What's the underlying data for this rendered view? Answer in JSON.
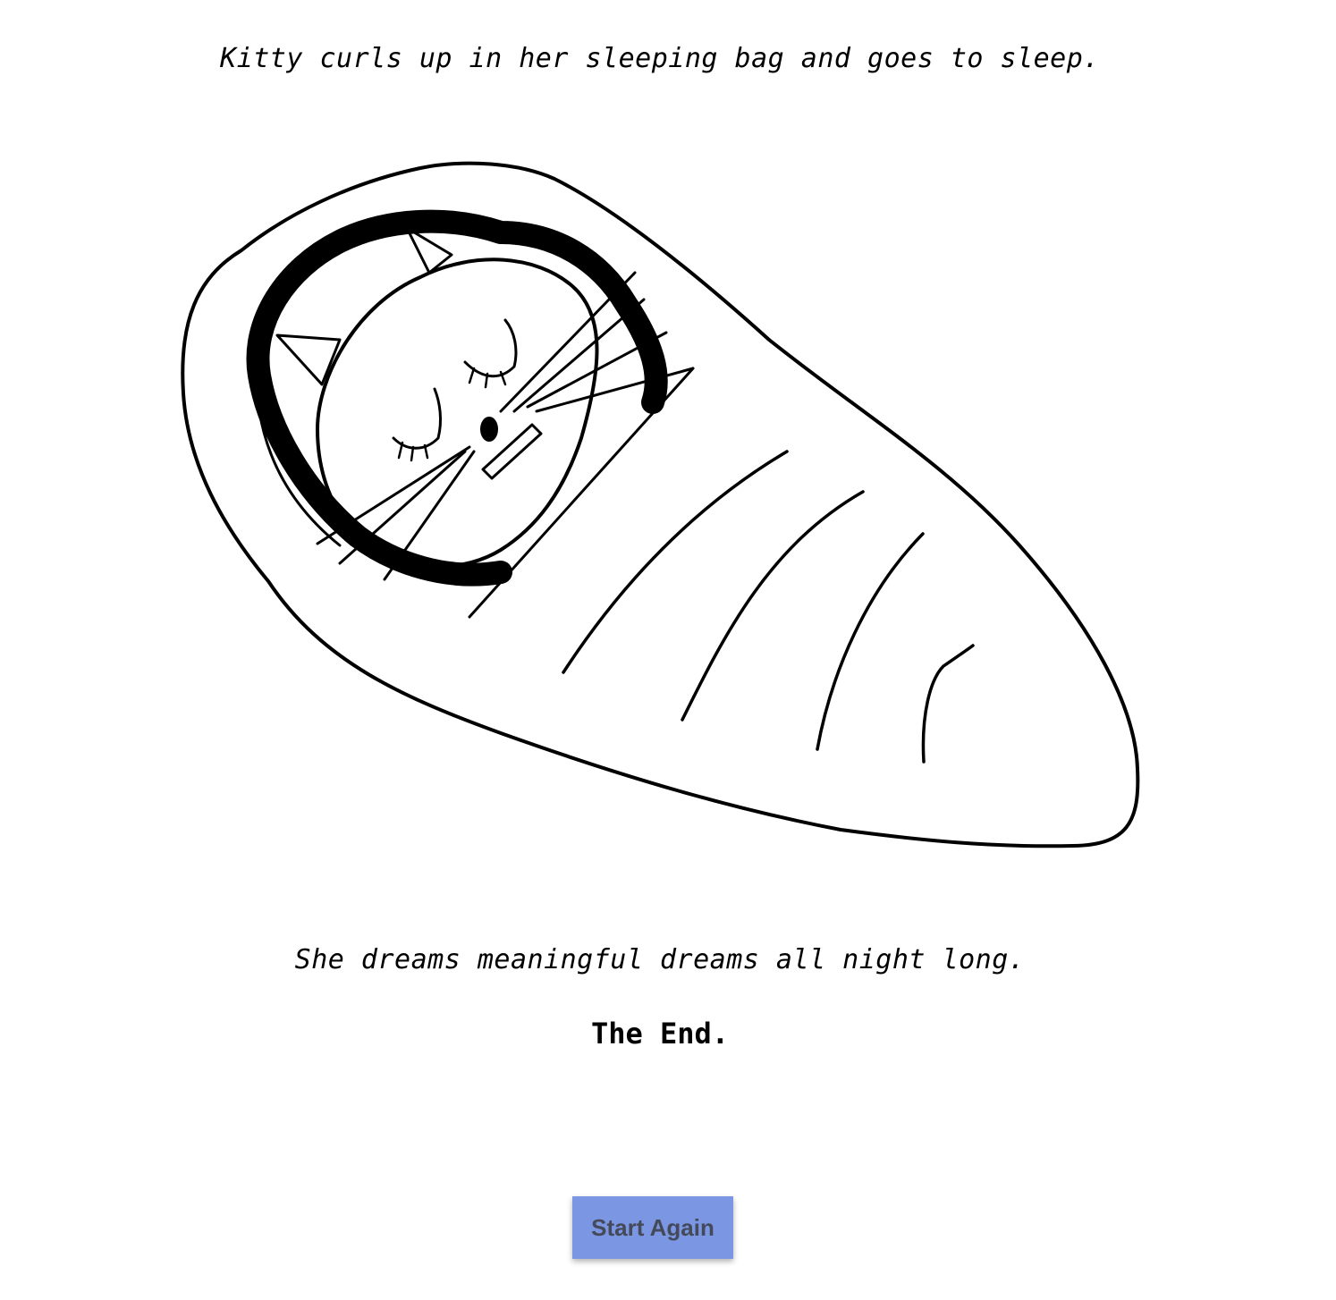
{
  "story": {
    "caption_top": "Kitty curls up in her sleeping bag and goes to sleep.",
    "caption_bottom": "She dreams meaningful dreams all night long.",
    "ending": "The End."
  },
  "illustration": {
    "icon": "sleeping-cat-in-bag-drawing"
  },
  "actions": {
    "start_again_label": "Start Again",
    "button_color": "#7b96e3"
  }
}
